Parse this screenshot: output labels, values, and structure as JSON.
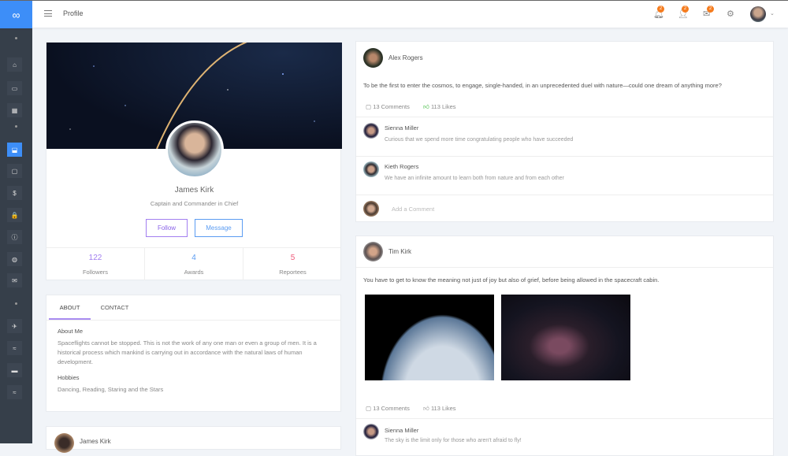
{
  "header": {
    "title": "Profile",
    "notifications_badge": "2",
    "users_badge": "2",
    "messages_badge": "2",
    "logo": "∞"
  },
  "sidebar": {
    "items": [
      {
        "icon": "home-icon",
        "glyph": "⌂"
      },
      {
        "icon": "folder-icon",
        "glyph": "▭"
      },
      {
        "icon": "grid-icon",
        "glyph": "▦"
      },
      {
        "icon": "user-icon",
        "glyph": "⬓"
      },
      {
        "icon": "chat-icon",
        "glyph": "▢"
      },
      {
        "icon": "dollar-icon",
        "glyph": "$"
      },
      {
        "icon": "lock-icon",
        "glyph": "🔒"
      },
      {
        "icon": "info-icon",
        "glyph": "ⓘ"
      },
      {
        "icon": "globe-icon",
        "glyph": "◍"
      },
      {
        "icon": "mail-icon",
        "glyph": "✉"
      },
      {
        "icon": "plane-icon",
        "glyph": "✈"
      },
      {
        "icon": "chart-icon",
        "glyph": "≈"
      },
      {
        "icon": "card-icon",
        "glyph": "▬"
      },
      {
        "icon": "wave-icon",
        "glyph": "≈"
      }
    ]
  },
  "profile": {
    "name": "James Kirk",
    "title": "Captain and Commander in Chief",
    "follow": "Follow",
    "message": "Message",
    "stats": [
      {
        "value": "122",
        "label": "Followers",
        "color": "#a27ff0"
      },
      {
        "value": "4",
        "label": "Awards",
        "color": "#5b9cf2"
      },
      {
        "value": "5",
        "label": "Reportees",
        "color": "#ef5a7a"
      }
    ]
  },
  "about": {
    "tabs": [
      "ABOUT",
      "CONTACT"
    ],
    "about_heading": "About Me",
    "about_text": "Spaceflights cannot be stopped. This is not the work of any one man or even a group of men. It is a historical process which mankind is carrying out in accordance with the natural laws of human development.",
    "hobbies_heading": "Hobbies",
    "hobbies_text": "Dancing, Reading, Staring and the Stars"
  },
  "mini_post": {
    "author": "James Kirk"
  },
  "posts": [
    {
      "author": "Alex Rogers",
      "text": "To be the first to enter the cosmos, to engage, single-handed, in an unprecedented duel with nature—could one dream of anything more?",
      "comments": "13 Comments",
      "likes": "113 Likes",
      "replies": [
        {
          "author": "Sienna Miller",
          "text": "Curious that we spend more time congratulating people who have succeeded"
        },
        {
          "author": "Kieth Rogers",
          "text": "We have an infinite amount to learn both from nature and from each other"
        }
      ],
      "add_comment_placeholder": "Add a Comment"
    },
    {
      "author": "Tim Kirk",
      "text": "You have to get to know the meaning not just of joy but also of grief, before being allowed in the spacecraft cabin.",
      "comments": "13 Comments",
      "likes": "113 Likes",
      "replies": [
        {
          "author": "Sienna Miller",
          "text": "The sky is the limit only for those who aren't afraid to fly!"
        }
      ]
    }
  ]
}
